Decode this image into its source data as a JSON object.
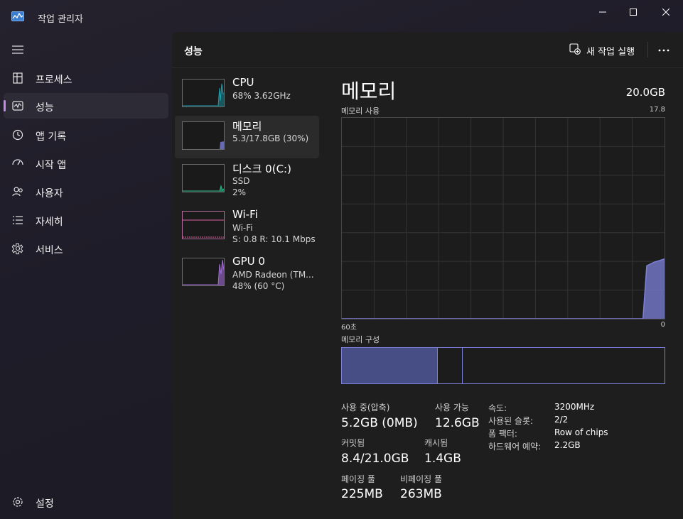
{
  "window": {
    "title": "작업 관리자",
    "controls": {
      "minimize": "minimize-icon",
      "maximize": "maximize-icon",
      "close": "close-icon"
    }
  },
  "sidebar": {
    "menu_icon": "hamburger-icon",
    "items": [
      {
        "label": "프로세스",
        "icon": "processes-icon",
        "active": false
      },
      {
        "label": "성능",
        "icon": "performance-icon",
        "active": true
      },
      {
        "label": "앱 기록",
        "icon": "history-icon",
        "active": false
      },
      {
        "label": "시작 앱",
        "icon": "startup-icon",
        "active": false
      },
      {
        "label": "사용자",
        "icon": "users-icon",
        "active": false
      },
      {
        "label": "자세히",
        "icon": "details-icon",
        "active": false
      },
      {
        "label": "서비스",
        "icon": "services-icon",
        "active": false
      }
    ],
    "settings_label": "설정"
  },
  "header": {
    "title": "성능",
    "new_task_label": "새 작업 실행",
    "more_icon": "more-icon"
  },
  "resources": [
    {
      "title": "CPU",
      "sub1": "68% 3.62GHz",
      "sub2": "",
      "color": "#17a3b2"
    },
    {
      "title": "메모리",
      "sub1": "5.3/17.8GB (30%)",
      "sub2": "",
      "color": "#7c80d8"
    },
    {
      "title": "디스크 0(C:)",
      "sub1": "SSD",
      "sub2": "2%",
      "color": "#2bb98c"
    },
    {
      "title": "Wi-Fi",
      "sub1": "Wi-Fi",
      "sub2": "S: 0.8 R: 10.1 Mbps",
      "color": "#d862a6"
    },
    {
      "title": "GPU 0",
      "sub1": "AMD Radeon (TM...",
      "sub2": "48% (60 °C)",
      "color": "#a36cd8"
    }
  ],
  "memory": {
    "title": "메모리",
    "total": "20.0GB",
    "graph_label": "메모리 사용",
    "graph_max": "17.8GB",
    "axis_left": "60초",
    "axis_right": "0",
    "composition_label": "메모리 구성",
    "stats": {
      "in_use_label": "사용 중(압축)",
      "in_use_value": "5.2GB (0MB)",
      "available_label": "사용 가능",
      "available_value": "12.6GB",
      "committed_label": "커밋됨",
      "committed_value": "8.4/21.0GB",
      "cached_label": "캐시됨",
      "cached_value": "1.4GB",
      "paged_label": "페이징 풀",
      "paged_value": "225MB",
      "nonpaged_label": "비페이징 풀",
      "nonpaged_value": "263MB"
    },
    "specs": {
      "speed_label": "속도:",
      "speed_value": "3200MHz",
      "slots_label": "사용된 슬롯:",
      "slots_value": "2/2",
      "form_label": "폼 팩터:",
      "form_value": "Row of chips",
      "reserved_label": "하드웨어 예약:",
      "reserved_value": "2.2GB"
    }
  },
  "chart_data": {
    "type": "area",
    "title": "메모리 사용",
    "xlabel": "",
    "ylabel": "",
    "xlim": [
      60,
      0
    ],
    "ylim": [
      0,
      17.8
    ],
    "series": [
      {
        "color": "#7c80d8",
        "x": [
          60,
          4,
          3.3,
          2,
          0
        ],
        "values": [
          0,
          0,
          4.7,
          5.0,
          5.3
        ]
      }
    ],
    "grid": true,
    "legend": "none"
  }
}
